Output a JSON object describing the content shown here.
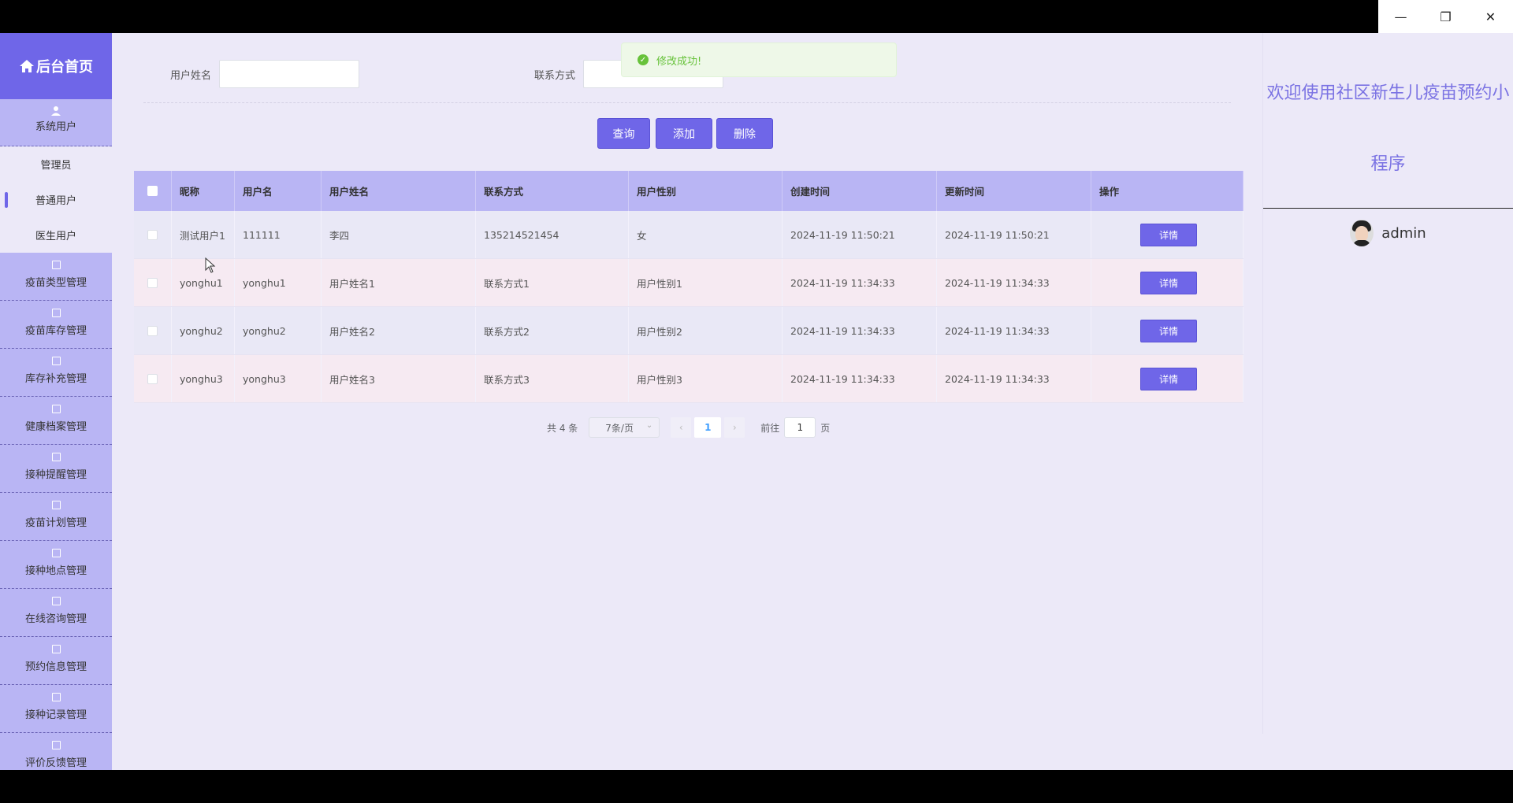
{
  "window_controls": {
    "minimize": "—",
    "restore": "❐",
    "close": "✕"
  },
  "sidebar": {
    "home_label": "后台首页",
    "system_user_label": "系统用户",
    "sub_items": [
      "管理员",
      "普通用户",
      "医生用户"
    ],
    "active_sub_item": "普通用户",
    "nav_items": [
      "疫苗类型管理",
      "疫苗库存管理",
      "库存补充管理",
      "健康档案管理",
      "接种提醒管理",
      "疫苗计划管理",
      "接种地点管理",
      "在线咨询管理",
      "预约信息管理",
      "接种记录管理",
      "评价反馈管理"
    ]
  },
  "search": {
    "name_label": "用户姓名",
    "name_value": "",
    "contact_label": "联系方式",
    "contact_value": ""
  },
  "toolbar": {
    "query_label": "查询",
    "add_label": "添加",
    "delete_label": "删除"
  },
  "toast": {
    "message": "修改成功!"
  },
  "table": {
    "headers": [
      "昵称",
      "用户名",
      "用户姓名",
      "联系方式",
      "用户性别",
      "创建时间",
      "更新时间",
      "操作"
    ],
    "rows": [
      [
        "测试用户1",
        "111111",
        "李四",
        "135214521454",
        "女",
        "2024-11-19 11:50:21",
        "2024-11-19 11:50:21"
      ],
      [
        "yonghu1",
        "yonghu1",
        "用户姓名1",
        "联系方式1",
        "用户性别1",
        "2024-11-19 11:34:33",
        "2024-11-19 11:34:33"
      ],
      [
        "yonghu2",
        "yonghu2",
        "用户姓名2",
        "联系方式2",
        "用户性别2",
        "2024-11-19 11:34:33",
        "2024-11-19 11:34:33"
      ],
      [
        "yonghu3",
        "yonghu3",
        "用户姓名3",
        "联系方式3",
        "用户性别3",
        "2024-11-19 11:34:33",
        "2024-11-19 11:34:33"
      ]
    ],
    "detail_label": "详情"
  },
  "pagination": {
    "total_text": "共 4 条",
    "page_size": "7条/页",
    "current_page": "1",
    "goto_label": "前往",
    "goto_value": "1",
    "page_suffix": "页"
  },
  "right_panel": {
    "welcome_text": "欢迎使用社区新生儿疫苗预约小程序",
    "username": "admin"
  },
  "colors": {
    "accent": "#6f66e8",
    "sidebar": "#b9b5f4",
    "background": "#ece9f8",
    "success": "#67c23a"
  }
}
